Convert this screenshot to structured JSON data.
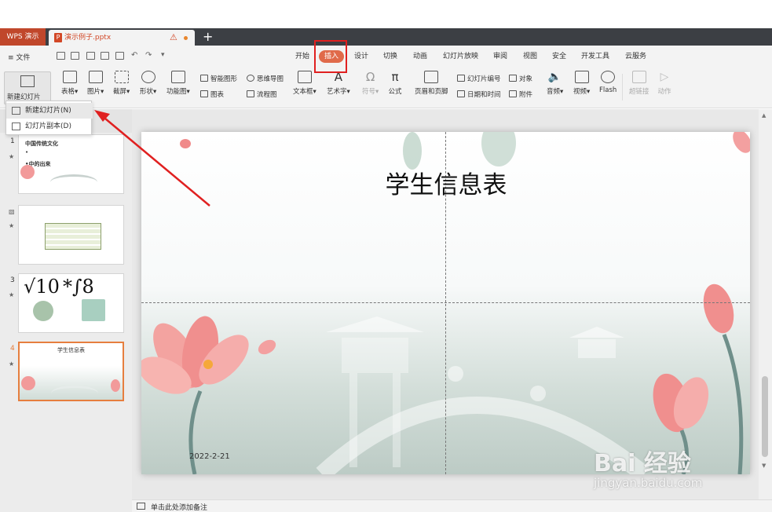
{
  "tabs": {
    "app": "WPS 演示",
    "doc": "演示例子.pptx",
    "warning_icon": "warning-icon",
    "add_tab": "+"
  },
  "menu": {
    "file": "≡ 文件",
    "items": [
      "开始",
      "插入",
      "设计",
      "切换",
      "动画",
      "幻灯片放映",
      "审阅",
      "视图",
      "安全",
      "开发工具",
      "云服务"
    ],
    "active_index": 1,
    "active_color": "#e06a4a"
  },
  "ribbon": {
    "new_slide": "新建幻灯片",
    "table": "表格",
    "picture": "图片",
    "screenshot": "截屏",
    "shape": "形状",
    "function_chart": "功能图",
    "smart_graphic": "智能图形",
    "chart": "图表",
    "mind_map": "思维导图",
    "flowchart": "流程图",
    "textbox": "文本框",
    "wordart": "艺术字",
    "symbol": "符号",
    "formula": "公式",
    "header_footer": "页眉和页脚",
    "slide_number": "幻灯片编号",
    "date_time": "日期和时间",
    "object": "对象",
    "attachment": "附件",
    "audio": "音频",
    "video": "视频",
    "flash": "Flash",
    "hyperlink": "超链接",
    "action": "动作"
  },
  "dropdown": {
    "items": [
      "新建幻灯片(N)",
      "幻灯片副本(D)"
    ]
  },
  "thumbnails": [
    {
      "num": "1",
      "texts": [
        "中国传统文化",
        "•",
        "•中的出来"
      ]
    },
    {
      "num": "",
      "texts": []
    },
    {
      "num": "3",
      "texts": [
        "√10",
        "*∫8"
      ]
    },
    {
      "num": "4",
      "texts": [
        "学生信息表"
      ],
      "selected": true
    }
  ],
  "slide": {
    "title": "学生信息表",
    "date": "2022-2-21"
  },
  "notes": {
    "placeholder": "单击此处添加备注"
  },
  "watermark": {
    "brand": "Bai  经验",
    "url": "jingyan.baidu.com"
  },
  "colors": {
    "accent": "#c0472b",
    "selection": "#e67e3e",
    "highlight_box": "#e02020"
  }
}
